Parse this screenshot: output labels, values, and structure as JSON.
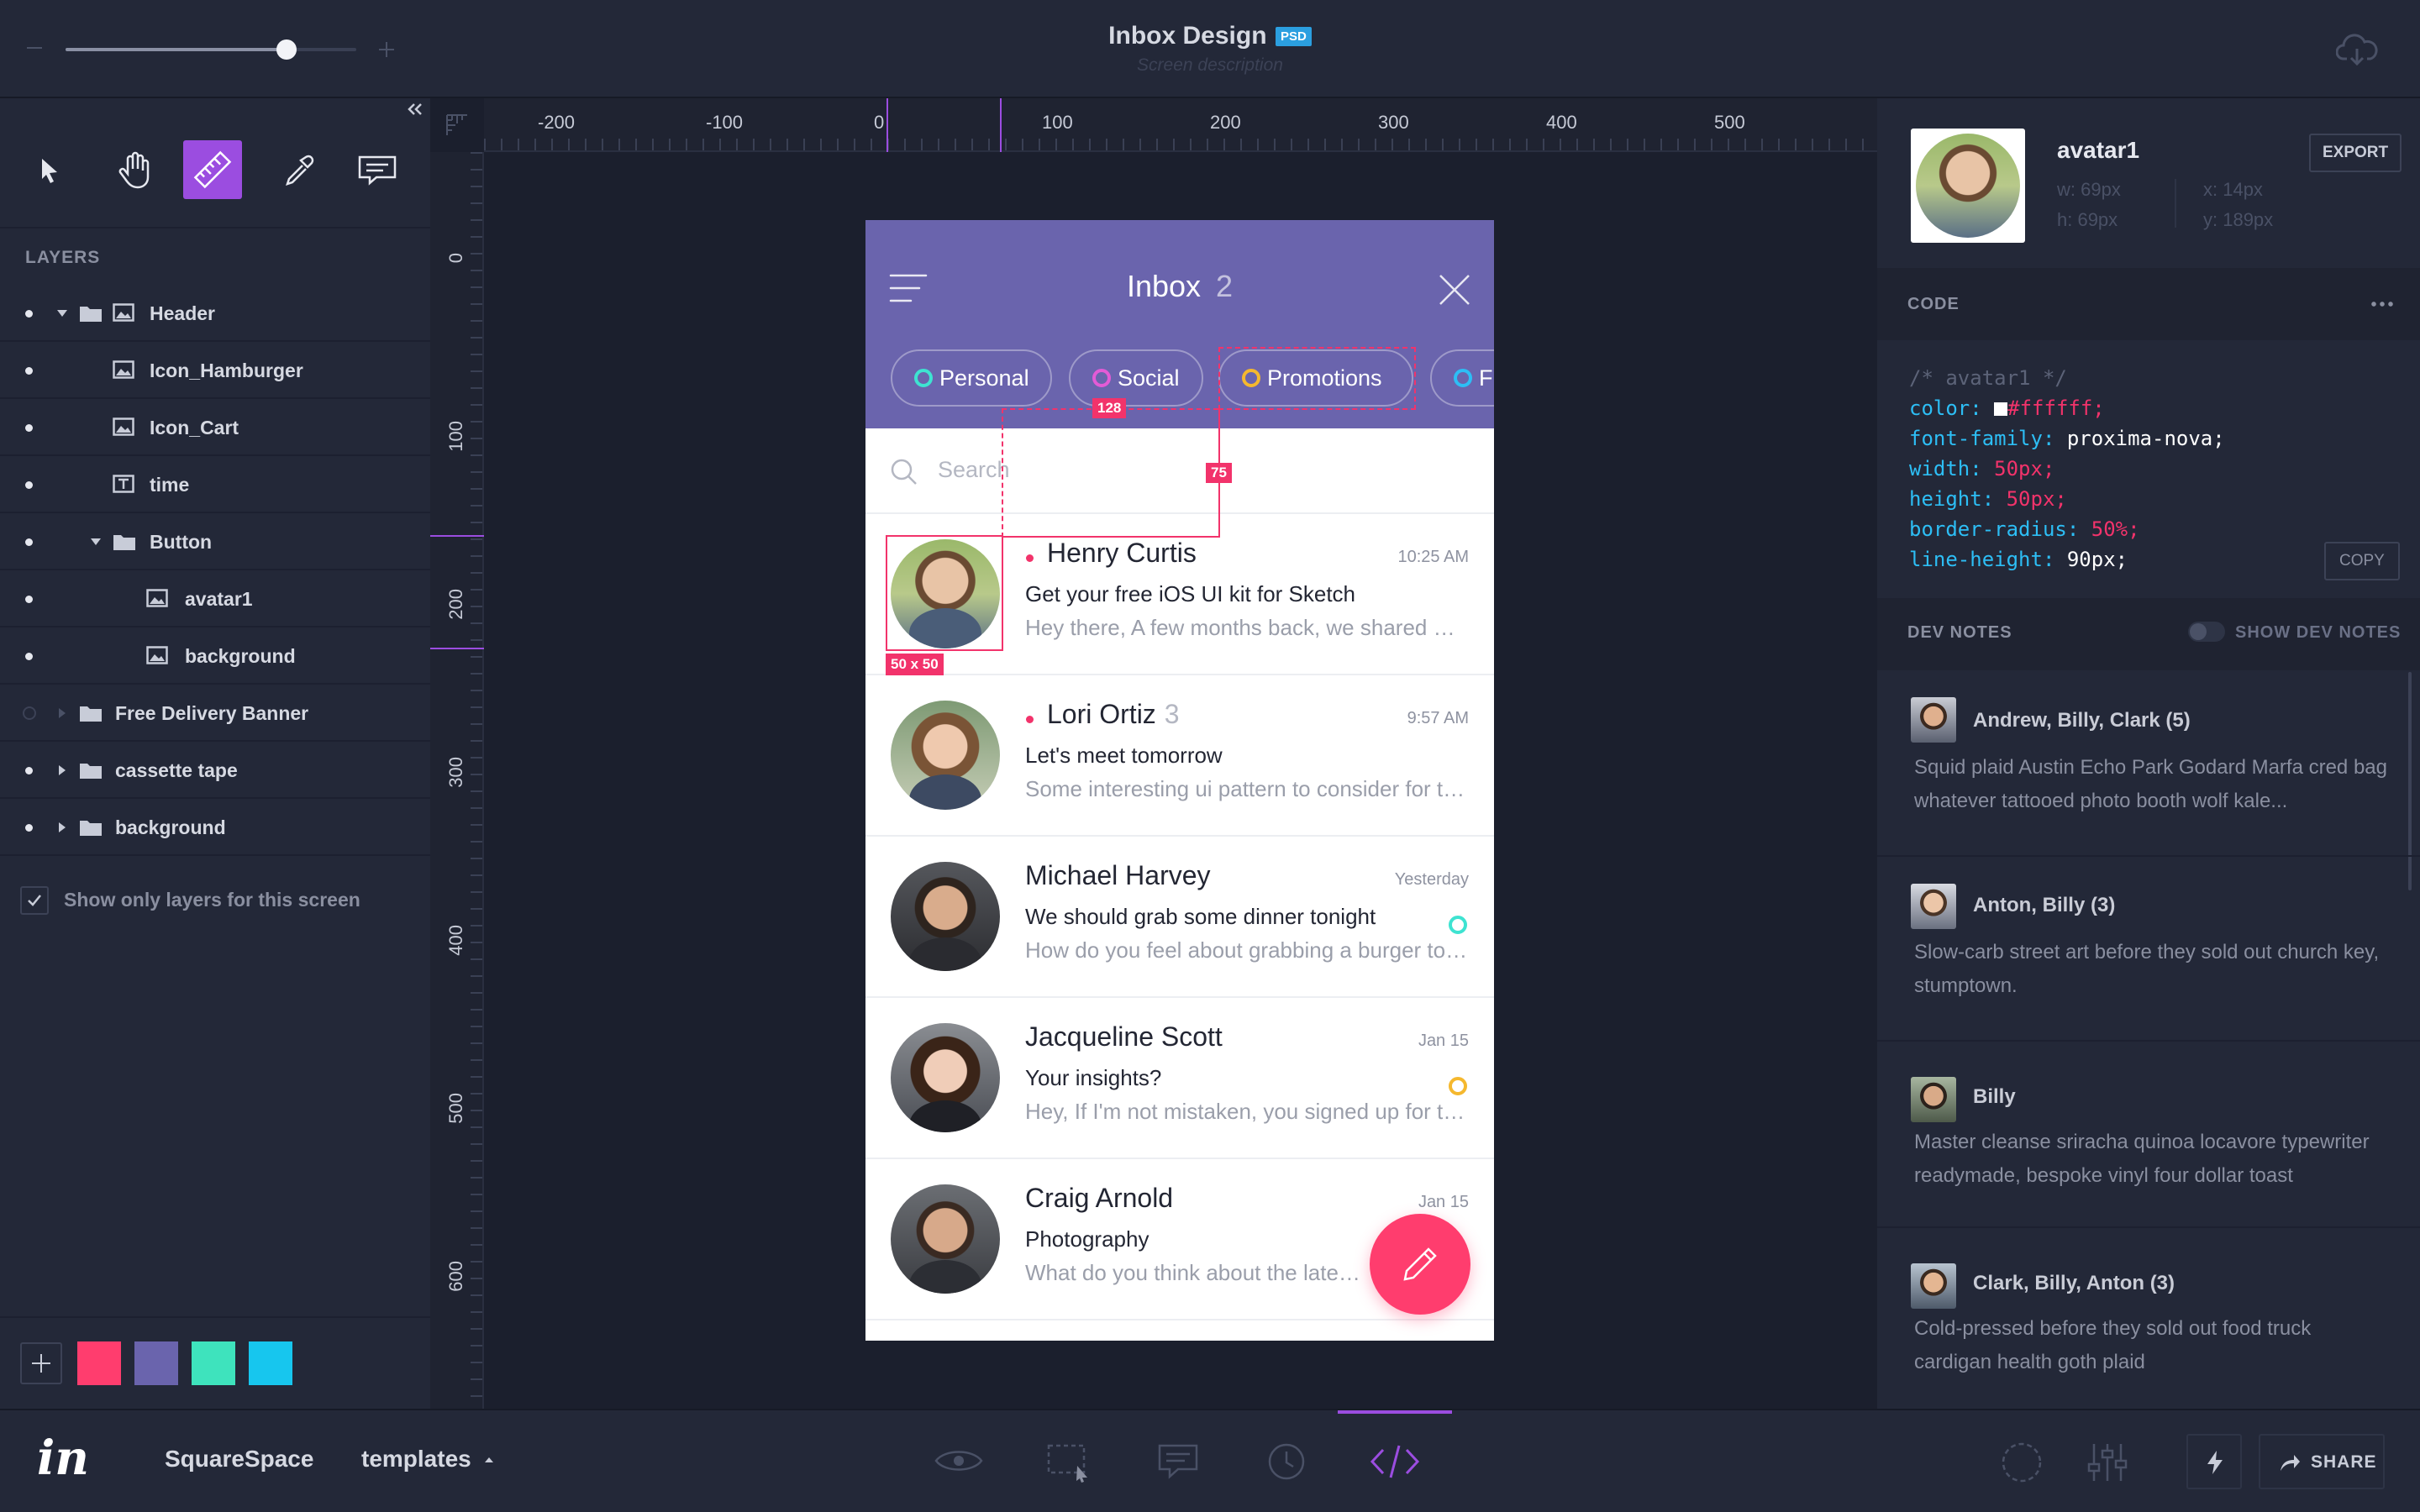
{
  "top": {
    "title": "Inbox Design",
    "badge": "PSD",
    "subtitle": "Screen description",
    "zoom_slider": 0.76
  },
  "tools": [
    "pointer-icon",
    "hand-icon",
    "ruler-icon",
    "eyedropper-icon",
    "comment-icon"
  ],
  "layers": {
    "heading": "LAYERS",
    "items": [
      {
        "label": "Header"
      },
      {
        "label": "Icon_Hamburger"
      },
      {
        "label": "Icon_Cart"
      },
      {
        "label": "time"
      },
      {
        "label": "Button"
      },
      {
        "label": "avatar1"
      },
      {
        "label": "background"
      },
      {
        "label": "Free Delivery Banner"
      },
      {
        "label": "cassette tape"
      },
      {
        "label": "background"
      }
    ],
    "show_only_label": "Show only layers for this screen",
    "swatches": [
      "#ff3d6e",
      "#6a64ad",
      "#3ee3bd",
      "#17c6ee"
    ]
  },
  "rulers": {
    "h": [
      "-200",
      "-100",
      "0",
      "100",
      "200",
      "300",
      "400",
      "500"
    ],
    "v": [
      "0",
      "100",
      "200",
      "300",
      "400",
      "500",
      "600"
    ]
  },
  "phone": {
    "title": "Inbox",
    "count": "2",
    "tabs": [
      "Personal",
      "Social",
      "Promotions",
      "Fi"
    ],
    "tab_colors": [
      "#3ee3d1",
      "#e35bd6",
      "#f5b82e",
      "#2dbef5"
    ],
    "search_placeholder": "Search",
    "measure_w": "128",
    "measure_h": "75",
    "size_label": "50 x 50",
    "messages": [
      {
        "name": "Henry Curtis",
        "count": "",
        "subject": "Get your free iOS UI kit for Sketch",
        "preview": "Hey there, A few months back, we shared with you some of our most popular work",
        "time": "10:25 AM",
        "unread": true
      },
      {
        "name": "Lori Ortiz",
        "count": "3",
        "subject": "Let's meet tomorrow",
        "preview": "Some interesting ui pattern to consider for the new project",
        "time": "9:57 AM",
        "unread": true
      },
      {
        "name": "Michael Harvey",
        "count": "",
        "subject": "We should grab some dinner tonight",
        "preview": "How do you feel about grabbing a burger tonight after work",
        "time": "Yesterday",
        "unread": false,
        "status": "#3ee3d1"
      },
      {
        "name": "Jacqueline Scott",
        "count": "",
        "subject": "Your insights?",
        "preview": "Hey, If I'm not mistaken, you signed up for the beta last week",
        "time": "Jan 15",
        "unread": false,
        "status": "#f5b82e"
      },
      {
        "name": "Craig Arnold",
        "count": "",
        "subject": "Photography",
        "preview": "What do you think about the latest photos",
        "time": "Jan 15",
        "unread": false
      }
    ]
  },
  "inspector": {
    "name": "avatar1",
    "export_label": "EXPORT",
    "w": "w: 69px",
    "h": "h: 69px",
    "x": "x: 14px",
    "y": "y: 189px",
    "code_heading": "CODE",
    "copy_label": "COPY",
    "code": {
      "comment": "/* avatar1 */",
      "lines": [
        {
          "prop": "color:",
          "val": "#ffffff;"
        },
        {
          "prop": "font-family:",
          "val": "proxima-nova;"
        },
        {
          "prop": "width:",
          "val": "50px;"
        },
        {
          "prop": "height:",
          "val": "50px;"
        },
        {
          "prop": "border-radius:",
          "val": "50%;"
        },
        {
          "prop": "line-height:",
          "val": "90px;"
        }
      ]
    },
    "dev_notes_heading": "DEV NOTES",
    "show_dev_notes": "SHOW DEV NOTES",
    "notes": [
      {
        "title": "Andrew, Billy, Clark (5)",
        "body": "Squid plaid Austin Echo Park Godard Marfa cred bag whatever tattooed photo booth wolf kale..."
      },
      {
        "title": "Anton, Billy (3)",
        "body": "Slow-carb street art before they sold out church key, stumptown."
      },
      {
        "title": "Billy",
        "body": "Master cleanse sriracha quinoa locavore typewriter readymade, bespoke vinyl four dollar toast"
      },
      {
        "title": "Clark, Billy, Anton (3)",
        "body": "Cold-pressed before they sold out food truck cardigan health goth plaid"
      }
    ]
  },
  "bottom": {
    "logo": "in",
    "project": "SquareSpace",
    "templates": "templates",
    "share": "SHARE"
  },
  "colors": {
    "accent": "#9b4de0",
    "brand_pink": "#ff3d6e",
    "phone_header": "#6a64ad"
  }
}
